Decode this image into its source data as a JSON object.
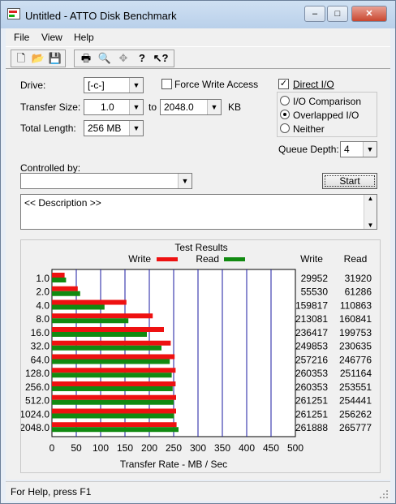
{
  "window": {
    "title": "Untitled - ATTO Disk Benchmark",
    "min": "–",
    "max": "□",
    "close": "✕"
  },
  "menu": [
    "File",
    "View",
    "Help"
  ],
  "toolbar": {
    "icons": [
      "new-icon",
      "open-icon",
      "save-icon",
      "print-icon",
      "print-preview-icon",
      "move-icon",
      "help-icon",
      "context-help-icon"
    ],
    "glyphs": [
      "🗋",
      "📂",
      "💾",
      "🖶",
      "🔍",
      "✥",
      "?",
      "↖?"
    ]
  },
  "form": {
    "drive_label": "Drive:",
    "drive_value": "[-c-]",
    "force_write_label": "Force Write Access",
    "force_write_checked": false,
    "direct_io_label": "Direct I/O",
    "direct_io_checked": true,
    "transfer_size_label": "Transfer Size:",
    "transfer_from": "1.0",
    "transfer_to_label": "to",
    "transfer_to": "2048.0",
    "transfer_unit": "KB",
    "total_length_label": "Total Length:",
    "total_length_value": "256 MB",
    "io_comparison_label": "I/O Comparison",
    "overlapped_io_label": "Overlapped I/O",
    "neither_label": "Neither",
    "selected_mode": "Overlapped I/O",
    "queue_depth_label": "Queue Depth:",
    "queue_depth_value": "4",
    "controlled_by_label": "Controlled by:",
    "controlled_by_value": "",
    "start_label": "Start",
    "description_text": "<< Description >>"
  },
  "results": {
    "title": "Test Results",
    "col_write": "Write",
    "col_read": "Read"
  },
  "chart_data": {
    "type": "bar",
    "orientation": "horizontal",
    "title": "Test Results",
    "xlabel": "Transfer Rate - MB / Sec",
    "xlim": [
      0,
      500
    ],
    "xticks": [
      "0",
      "50",
      "100",
      "150",
      "200",
      "250",
      "300",
      "350",
      "400",
      "450",
      "500"
    ],
    "grid": true,
    "legend_placement": "top",
    "categories": [
      "1.0",
      "2.0",
      "4.0",
      "8.0",
      "16.0",
      "32.0",
      "64.0",
      "128.0",
      "256.0",
      "512.0",
      "1024.0",
      "2048.0"
    ],
    "series": [
      {
        "name": "Write",
        "color": "#ee1111",
        "values": [
          26,
          53,
          153,
          207,
          230,
          244,
          252,
          254,
          254,
          255,
          255,
          256
        ]
      },
      {
        "name": "Read",
        "color": "#118a11",
        "values": [
          29,
          58,
          108,
          157,
          195,
          225,
          242,
          246,
          248,
          250,
          251,
          260
        ]
      }
    ],
    "table": {
      "write": [
        "29952",
        "55530",
        "159817",
        "213081",
        "236417",
        "249853",
        "257216",
        "260353",
        "260353",
        "261251",
        "261251",
        "261888"
      ],
      "read": [
        "31920",
        "61286",
        "110863",
        "160841",
        "199753",
        "230635",
        "246776",
        "251164",
        "253551",
        "254441",
        "256262",
        "265777"
      ]
    }
  },
  "status": {
    "text": "For Help, press F1"
  }
}
